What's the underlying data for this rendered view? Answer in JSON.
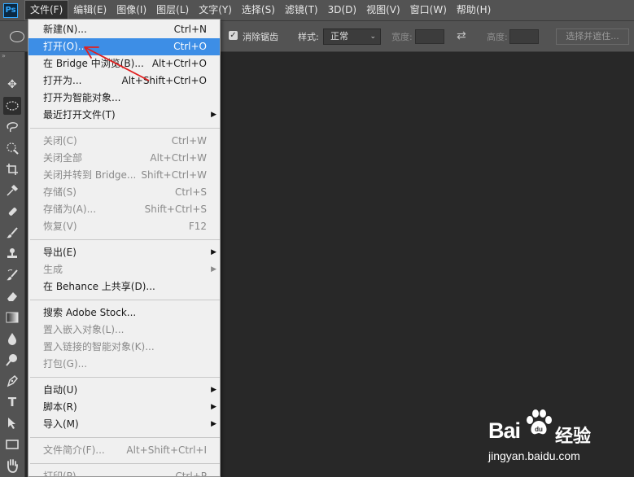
{
  "app": {
    "logo": "Ps"
  },
  "menubar": {
    "items": [
      "文件(F)",
      "编辑(E)",
      "图像(I)",
      "图层(L)",
      "文字(Y)",
      "选择(S)",
      "滤镜(T)",
      "3D(D)",
      "视图(V)",
      "窗口(W)",
      "帮助(H)"
    ]
  },
  "options": {
    "antialias_label": "消除锯齿",
    "style_label": "样式:",
    "style_value": "正常",
    "width_label": "宽度:",
    "height_label": "高度:",
    "select_mask_button": "选择并遮住..."
  },
  "file_menu": {
    "group1": [
      {
        "label": "新建(N)...",
        "shortcut": "Ctrl+N",
        "enabled": true
      },
      {
        "label": "打开(O)...",
        "shortcut": "Ctrl+O",
        "enabled": true,
        "highlighted": true
      },
      {
        "label": "在 Bridge 中浏览(B)...",
        "shortcut": "Alt+Ctrl+O",
        "enabled": true
      },
      {
        "label": "打开为...",
        "shortcut": "Alt+Shift+Ctrl+O",
        "enabled": true
      },
      {
        "label": "打开为智能对象...",
        "shortcut": "",
        "enabled": true
      },
      {
        "label": "最近打开文件(T)",
        "shortcut": "",
        "enabled": true,
        "submenu": true
      }
    ],
    "group2": [
      {
        "label": "关闭(C)",
        "shortcut": "Ctrl+W",
        "enabled": false
      },
      {
        "label": "关闭全部",
        "shortcut": "Alt+Ctrl+W",
        "enabled": false
      },
      {
        "label": "关闭并转到 Bridge...",
        "shortcut": "Shift+Ctrl+W",
        "enabled": false
      },
      {
        "label": "存储(S)",
        "shortcut": "Ctrl+S",
        "enabled": false
      },
      {
        "label": "存储为(A)...",
        "shortcut": "Shift+Ctrl+S",
        "enabled": false
      },
      {
        "label": "恢复(V)",
        "shortcut": "F12",
        "enabled": false
      }
    ],
    "group3": [
      {
        "label": "导出(E)",
        "shortcut": "",
        "enabled": true,
        "submenu": true
      },
      {
        "label": "生成",
        "shortcut": "",
        "enabled": false,
        "submenu": true
      },
      {
        "label": "在 Behance 上共享(D)...",
        "shortcut": "",
        "enabled": true
      }
    ],
    "group4": [
      {
        "label": "搜索 Adobe Stock...",
        "shortcut": "",
        "enabled": true
      },
      {
        "label": "置入嵌入对象(L)...",
        "shortcut": "",
        "enabled": false
      },
      {
        "label": "置入链接的智能对象(K)...",
        "shortcut": "",
        "enabled": false
      },
      {
        "label": "打包(G)...",
        "shortcut": "",
        "enabled": false
      }
    ],
    "group5": [
      {
        "label": "自动(U)",
        "shortcut": "",
        "enabled": true,
        "submenu": true
      },
      {
        "label": "脚本(R)",
        "shortcut": "",
        "enabled": true,
        "submenu": true
      },
      {
        "label": "导入(M)",
        "shortcut": "",
        "enabled": true,
        "submenu": true
      }
    ],
    "group6": [
      {
        "label": "文件简介(F)...",
        "shortcut": "Alt+Shift+Ctrl+I",
        "enabled": false
      }
    ],
    "group7": [
      {
        "label": "打印(P)...",
        "shortcut": "Ctrl+P",
        "enabled": false
      }
    ]
  },
  "tools": [
    "move-icon",
    "elliptical-marquee-icon",
    "lasso-icon",
    "quick-selection-icon",
    "crop-icon",
    "eyedropper-icon",
    "healing-brush-icon",
    "brush-icon",
    "clone-stamp-icon",
    "history-brush-icon",
    "eraser-icon",
    "gradient-icon",
    "blur-icon",
    "dodge-icon",
    "pen-icon",
    "type-icon",
    "path-selection-icon",
    "rectangle-icon",
    "hand-icon"
  ],
  "watermark": {
    "brand": "Bai",
    "brand_cn": "经验",
    "url": "jingyan.baidu.com"
  },
  "colors": {
    "highlight": "#3d8ee6",
    "annotation_arrow": "#e02020"
  }
}
